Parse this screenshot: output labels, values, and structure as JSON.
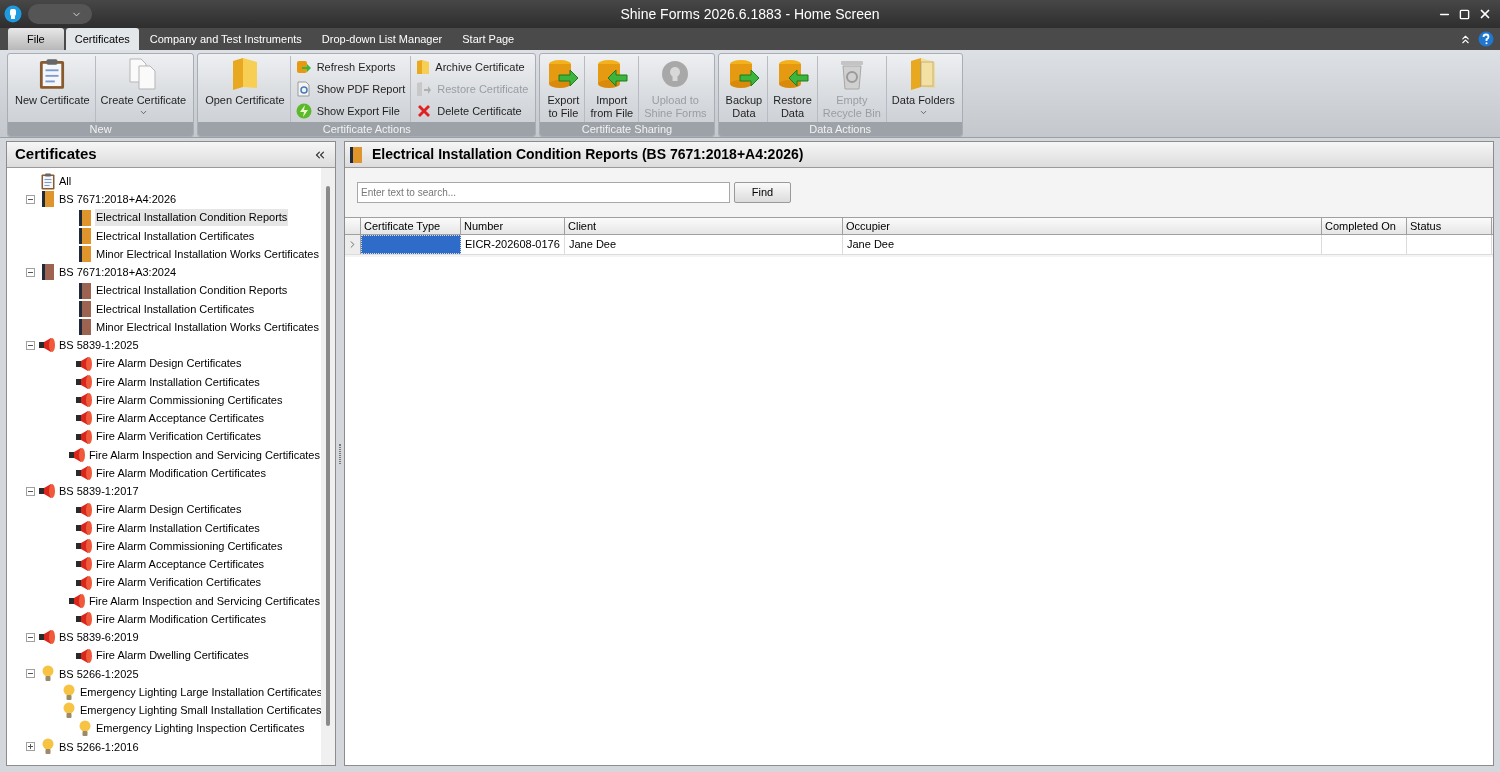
{
  "window": {
    "title": "Shine Forms 2026.6.1883 - Home Screen"
  },
  "tabs": [
    {
      "label": "File",
      "selected": false,
      "kind": "file"
    },
    {
      "label": "Certificates",
      "selected": true,
      "kind": "tab"
    },
    {
      "label": "Company and Test Instruments",
      "selected": false,
      "kind": "tab"
    },
    {
      "label": "Drop-down List Manager",
      "selected": false,
      "kind": "tab"
    },
    {
      "label": "Start Page",
      "selected": false,
      "kind": "tab"
    }
  ],
  "ribbon_groups": [
    {
      "label": "New",
      "buttons": [
        {
          "kind": "large",
          "label": "New Certificate",
          "disabled": false
        },
        {
          "kind": "large",
          "label": "Create Certificate",
          "disabled": false,
          "dropdown": true
        }
      ]
    },
    {
      "label": "Certificate Actions",
      "buttons": [
        {
          "kind": "large",
          "label": "Open Certificate",
          "disabled": false
        },
        {
          "kind": "small",
          "label": "Refresh Exports",
          "disabled": false
        },
        {
          "kind": "small",
          "label": "Show PDF Report",
          "disabled": false
        },
        {
          "kind": "small",
          "label": "Show Export File",
          "disabled": false
        },
        {
          "kind": "small",
          "label": "Archive Certificate",
          "disabled": false
        },
        {
          "kind": "small",
          "label": "Restore Certificate",
          "disabled": true
        },
        {
          "kind": "small",
          "label": "Delete Certificate",
          "disabled": false
        }
      ]
    },
    {
      "label": "Certificate Sharing",
      "buttons": [
        {
          "kind": "large",
          "label": "Export\nto File",
          "disabled": false
        },
        {
          "kind": "large",
          "label": "Import\nfrom File",
          "disabled": false
        },
        {
          "kind": "large",
          "label": "Upload to\nShine Forms",
          "disabled": true
        }
      ]
    },
    {
      "label": "Data Actions",
      "buttons": [
        {
          "kind": "large",
          "label": "Backup\nData",
          "disabled": false
        },
        {
          "kind": "large",
          "label": "Restore\nData",
          "disabled": false
        },
        {
          "kind": "large",
          "label": "Empty\nRecycle Bin",
          "disabled": true
        },
        {
          "kind": "large",
          "label": "Data Folders",
          "disabled": false,
          "dropdown": true
        }
      ]
    }
  ],
  "sidebar": {
    "title": "Certificates",
    "tree": [
      {
        "label": "All",
        "kind": "clipboard",
        "selected": false
      },
      {
        "label": "BS 7671:2018+A4:2026",
        "kind": "book",
        "color": "#e0952c",
        "selected": false,
        "expanded": true,
        "children": [
          {
            "label": "Electrical Installation Condition Reports",
            "kind": "book",
            "color": "#e0952c",
            "selected": true
          },
          {
            "label": "Electrical Installation Certificates",
            "kind": "book",
            "color": "#e0952c",
            "selected": false
          },
          {
            "label": "Minor Electrical Installation Works Certificates",
            "kind": "book",
            "color": "#e0952c",
            "selected": false
          }
        ]
      },
      {
        "label": "BS 7671:2018+A3:2024",
        "kind": "book",
        "color": "#9c6450",
        "selected": false,
        "expanded": true,
        "children": [
          {
            "label": "Electrical Installation Condition Reports",
            "kind": "book",
            "color": "#9c6450",
            "selected": false
          },
          {
            "label": "Electrical Installation Certificates",
            "kind": "book",
            "color": "#9c6450",
            "selected": false
          },
          {
            "label": "Minor Electrical Installation Works Certificates",
            "kind": "book",
            "color": "#9c6450",
            "selected": false
          }
        ]
      },
      {
        "label": "BS 5839-1:2025",
        "kind": "siren",
        "selected": false,
        "expanded": true,
        "children": [
          {
            "label": "Fire Alarm Design Certificates",
            "kind": "siren",
            "selected": false
          },
          {
            "label": "Fire Alarm Installation Certificates",
            "kind": "siren",
            "selected": false
          },
          {
            "label": "Fire Alarm Commissioning Certificates",
            "kind": "siren",
            "selected": false
          },
          {
            "label": "Fire Alarm Acceptance Certificates",
            "kind": "siren",
            "selected": false
          },
          {
            "label": "Fire Alarm Verification Certificates",
            "kind": "siren",
            "selected": false
          },
          {
            "label": "Fire Alarm Inspection and Servicing Certificates",
            "kind": "siren",
            "selected": false
          },
          {
            "label": "Fire Alarm Modification Certificates",
            "kind": "siren",
            "selected": false
          }
        ]
      },
      {
        "label": "BS 5839-1:2017",
        "kind": "siren",
        "selected": false,
        "expanded": true,
        "children": [
          {
            "label": "Fire Alarm Design Certificates",
            "kind": "siren",
            "selected": false
          },
          {
            "label": "Fire Alarm Installation Certificates",
            "kind": "siren",
            "selected": false
          },
          {
            "label": "Fire Alarm Commissioning Certificates",
            "kind": "siren",
            "selected": false
          },
          {
            "label": "Fire Alarm Acceptance Certificates",
            "kind": "siren",
            "selected": false
          },
          {
            "label": "Fire Alarm Verification Certificates",
            "kind": "siren",
            "selected": false
          },
          {
            "label": "Fire Alarm Inspection and Servicing Certificates",
            "kind": "siren",
            "selected": false
          },
          {
            "label": "Fire Alarm Modification Certificates",
            "kind": "siren",
            "selected": false
          }
        ]
      },
      {
        "label": "BS 5839-6:2019",
        "kind": "siren",
        "selected": false,
        "expanded": true,
        "children": [
          {
            "label": "Fire Alarm Dwelling Certificates",
            "kind": "siren",
            "selected": false
          }
        ]
      },
      {
        "label": "BS 5266-1:2025",
        "kind": "bulb",
        "selected": false,
        "expanded": true,
        "children": [
          {
            "label": "Emergency Lighting Large Installation Certificates",
            "kind": "bulb",
            "selected": false
          },
          {
            "label": "Emergency Lighting Small Installation Certificates",
            "kind": "bulb",
            "selected": false
          },
          {
            "label": "Emergency Lighting Inspection Certificates",
            "kind": "bulb",
            "selected": false
          }
        ]
      },
      {
        "label": "BS 5266-1:2016",
        "kind": "bulb",
        "selected": false,
        "expanded": false
      }
    ]
  },
  "panel": {
    "title": "Electrical Installation Condition Reports (BS 7671:2018+A4:2026)",
    "color": "#e0952c",
    "search": {
      "placeholder": "Enter text to search..."
    },
    "find_button": "Find"
  },
  "table": {
    "columns": [
      "Certificate Type",
      "Number",
      "Client",
      "Occupier",
      "Completed On",
      "Status"
    ],
    "rows": [
      {
        "selected": true,
        "cells": {
          "number": "EICR-202608-0176",
          "client": "Jane Dee",
          "occupier": "Jane Dee"
        }
      }
    ]
  }
}
